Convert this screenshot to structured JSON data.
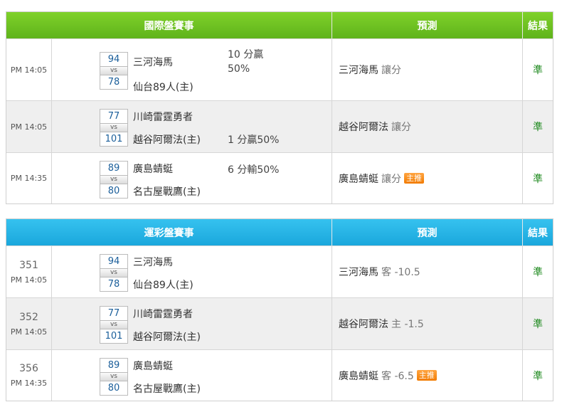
{
  "intl": {
    "header": {
      "match": "國際盤賽事",
      "prediction": "預測",
      "result": "結果"
    },
    "rows": [
      {
        "time": "PM 14:05",
        "score_a": "94",
        "vs": "vs",
        "score_b": "78",
        "team_a": "三河海馬",
        "team_b": "仙台89人(主)",
        "handicap": "10 分贏\n50%",
        "pred_team": "三河海馬",
        "pred_type": "讓分",
        "badge": "",
        "result": "準"
      },
      {
        "time": "PM 14:05",
        "score_a": "77",
        "vs": "vs",
        "score_b": "101",
        "team_a": "川崎雷霆勇者",
        "team_b": "越谷阿爾法(主)",
        "handicap": "1 分贏50%",
        "pred_team": "越谷阿爾法",
        "pred_type": "讓分",
        "badge": "",
        "result": "準"
      },
      {
        "time": "PM 14:35",
        "score_a": "89",
        "vs": "vs",
        "score_b": "80",
        "team_a": "廣島蜻蜓",
        "team_b": "名古屋戰鷹(主)",
        "handicap": "6 分輸50%",
        "pred_team": "廣島蜻蜓",
        "pred_type": "讓分",
        "badge": "主推",
        "result": "準"
      }
    ]
  },
  "lottery": {
    "header": {
      "match": "運彩盤賽事",
      "prediction": "預測",
      "result": "結果"
    },
    "rows": [
      {
        "num": "351",
        "time": "PM 14:05",
        "score_a": "94",
        "vs": "vs",
        "score_b": "78",
        "team_a": "三河海馬",
        "team_b": "仙台89人(主)",
        "pred_team": "三河海馬",
        "pred_type": "客 -10.5",
        "badge": "",
        "result": "準"
      },
      {
        "num": "352",
        "time": "PM 14:05",
        "score_a": "77",
        "vs": "vs",
        "score_b": "101",
        "team_a": "川崎雷霆勇者",
        "team_b": "越谷阿爾法(主)",
        "pred_team": "越谷阿爾法",
        "pred_type": "主 -1.5",
        "badge": "",
        "result": "準"
      },
      {
        "num": "356",
        "time": "PM 14:35",
        "score_a": "89",
        "vs": "vs",
        "score_b": "80",
        "team_a": "廣島蜻蜓",
        "team_b": "名古屋戰鷹(主)",
        "pred_team": "廣島蜻蜓",
        "pred_type": "客 -6.5",
        "badge": "主推",
        "result": "準"
      }
    ]
  }
}
